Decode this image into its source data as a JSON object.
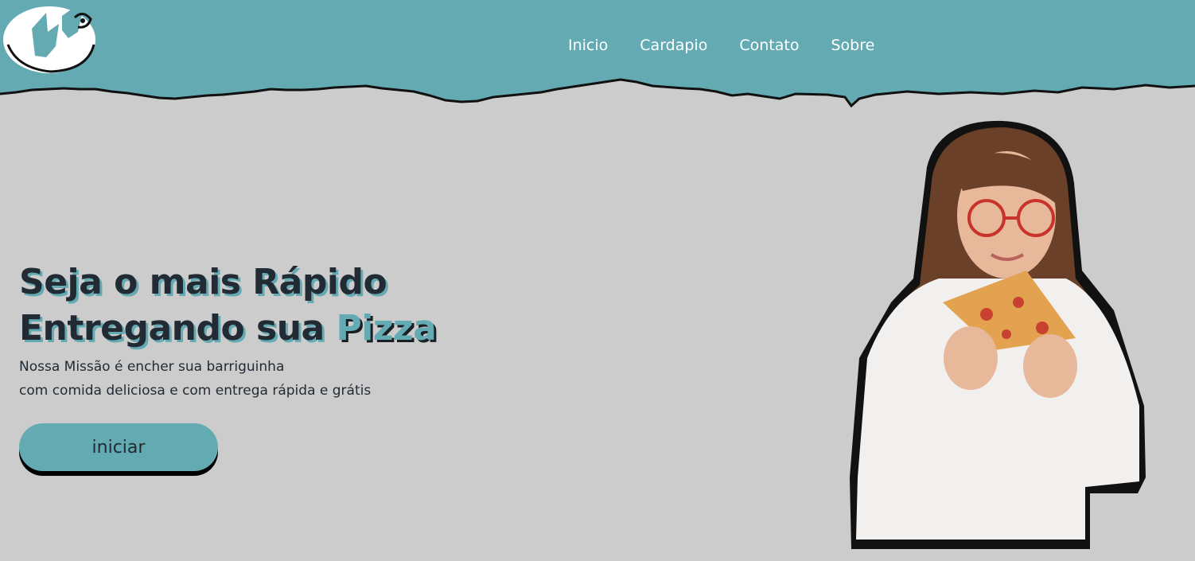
{
  "nav": {
    "items": [
      {
        "label": "Inicio"
      },
      {
        "label": "Cardapio"
      },
      {
        "label": "Contato"
      },
      {
        "label": "Sobre"
      }
    ]
  },
  "hero": {
    "title_line1": "Seja o mais Rápido",
    "title_line2_prefix": "Entregando sua ",
    "title_line2_accent": "Pizza",
    "subtitle_line1": "Nossa Missão é encher sua barriguinha",
    "subtitle_line2": "com comida deliciosa e com entrega rápida e grátis",
    "cta_label": "iniciar"
  },
  "colors": {
    "brand": "#63aab3",
    "background": "#cccccc",
    "text": "#222b33"
  },
  "icons": {
    "logo": "brand-logo-icon",
    "photo": "woman-eating-pizza-photo"
  }
}
